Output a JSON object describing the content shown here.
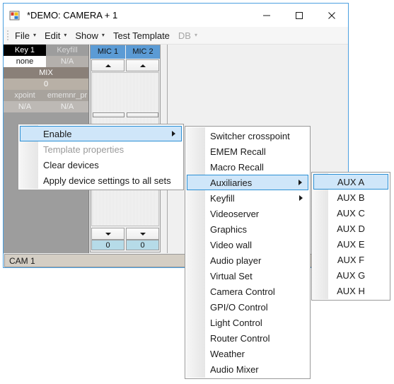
{
  "window": {
    "title": "*DEMO: CAMERA + 1",
    "icon": "app-window-icon",
    "minimize_label": "—",
    "maximize_label": "□",
    "close_label": "✕"
  },
  "menubar": {
    "items": [
      {
        "label": "File",
        "caret": "▾",
        "disabled": false
      },
      {
        "label": "Edit",
        "caret": "▾",
        "disabled": false
      },
      {
        "label": "Show",
        "caret": "▾",
        "disabled": false
      },
      {
        "label": "Test Template",
        "caret": "",
        "disabled": false
      },
      {
        "label": "DB",
        "caret": "▾",
        "disabled": true
      }
    ]
  },
  "device_column": {
    "rows": [
      {
        "left": "Key 1",
        "right": "Keyfill"
      },
      {
        "left": "none",
        "right": "N/A"
      },
      {
        "full": "MIX"
      },
      {
        "full": "0"
      },
      {
        "left": "xpoint",
        "right": "ememnr_pr"
      },
      {
        "left": "N/A",
        "right": "N/A"
      }
    ]
  },
  "mic_panel": {
    "channels": [
      {
        "name": "MIC 1",
        "up": "▲",
        "down": "▼",
        "value": "0"
      },
      {
        "name": "MIC 2",
        "up": "▲",
        "down": "▼",
        "value": "0"
      }
    ]
  },
  "status_bar": {
    "text": "CAM 1"
  },
  "context_menu": {
    "items": [
      {
        "label": "Enable",
        "disabled": false,
        "selected": true,
        "submenu": true
      },
      {
        "label": "Template properties",
        "disabled": true,
        "selected": false,
        "submenu": false
      },
      {
        "label": "Clear devices",
        "disabled": false,
        "selected": false,
        "submenu": false
      },
      {
        "label": "Apply device settings to all sets",
        "disabled": false,
        "selected": false,
        "submenu": false
      }
    ]
  },
  "enable_submenu": {
    "items": [
      {
        "label": "Switcher crosspoint",
        "selected": false,
        "submenu": false
      },
      {
        "label": "EMEM Recall",
        "selected": false,
        "submenu": false
      },
      {
        "label": "Macro Recall",
        "selected": false,
        "submenu": false
      },
      {
        "label": "Auxiliaries",
        "selected": true,
        "submenu": true
      },
      {
        "label": "Keyfill",
        "selected": false,
        "submenu": true
      },
      {
        "label": "Videoserver",
        "selected": false,
        "submenu": false
      },
      {
        "label": "Graphics",
        "selected": false,
        "submenu": false
      },
      {
        "label": "Video wall",
        "selected": false,
        "submenu": false
      },
      {
        "label": "Audio player",
        "selected": false,
        "submenu": false
      },
      {
        "label": "Virtual Set",
        "selected": false,
        "submenu": false
      },
      {
        "label": "Camera Control",
        "selected": false,
        "submenu": false
      },
      {
        "label": "GPI/O Control",
        "selected": false,
        "submenu": false
      },
      {
        "label": "Light Control",
        "selected": false,
        "submenu": false
      },
      {
        "label": "Router Control",
        "selected": false,
        "submenu": false
      },
      {
        "label": "Weather",
        "selected": false,
        "submenu": false
      },
      {
        "label": "Audio Mixer",
        "selected": false,
        "submenu": false
      }
    ]
  },
  "auxiliaries_submenu": {
    "items": [
      {
        "label": "AUX A",
        "selected": true
      },
      {
        "label": "AUX B",
        "selected": false
      },
      {
        "label": "AUX C",
        "selected": false
      },
      {
        "label": "AUX D",
        "selected": false
      },
      {
        "label": "AUX E",
        "selected": false
      },
      {
        "label": "AUX F",
        "selected": false
      },
      {
        "label": "AUX G",
        "selected": false
      },
      {
        "label": "AUX H",
        "selected": false
      }
    ]
  },
  "colors": {
    "window_border": "#4ba0e0",
    "menu_highlight_fill": "#cfe6f9",
    "menu_highlight_border": "#2b8fd4",
    "mic_header": "#5b9bd5",
    "mic_value": "#b6dbe8",
    "status_bar": "#d4cec4",
    "device_column": "#9d9d9d"
  }
}
